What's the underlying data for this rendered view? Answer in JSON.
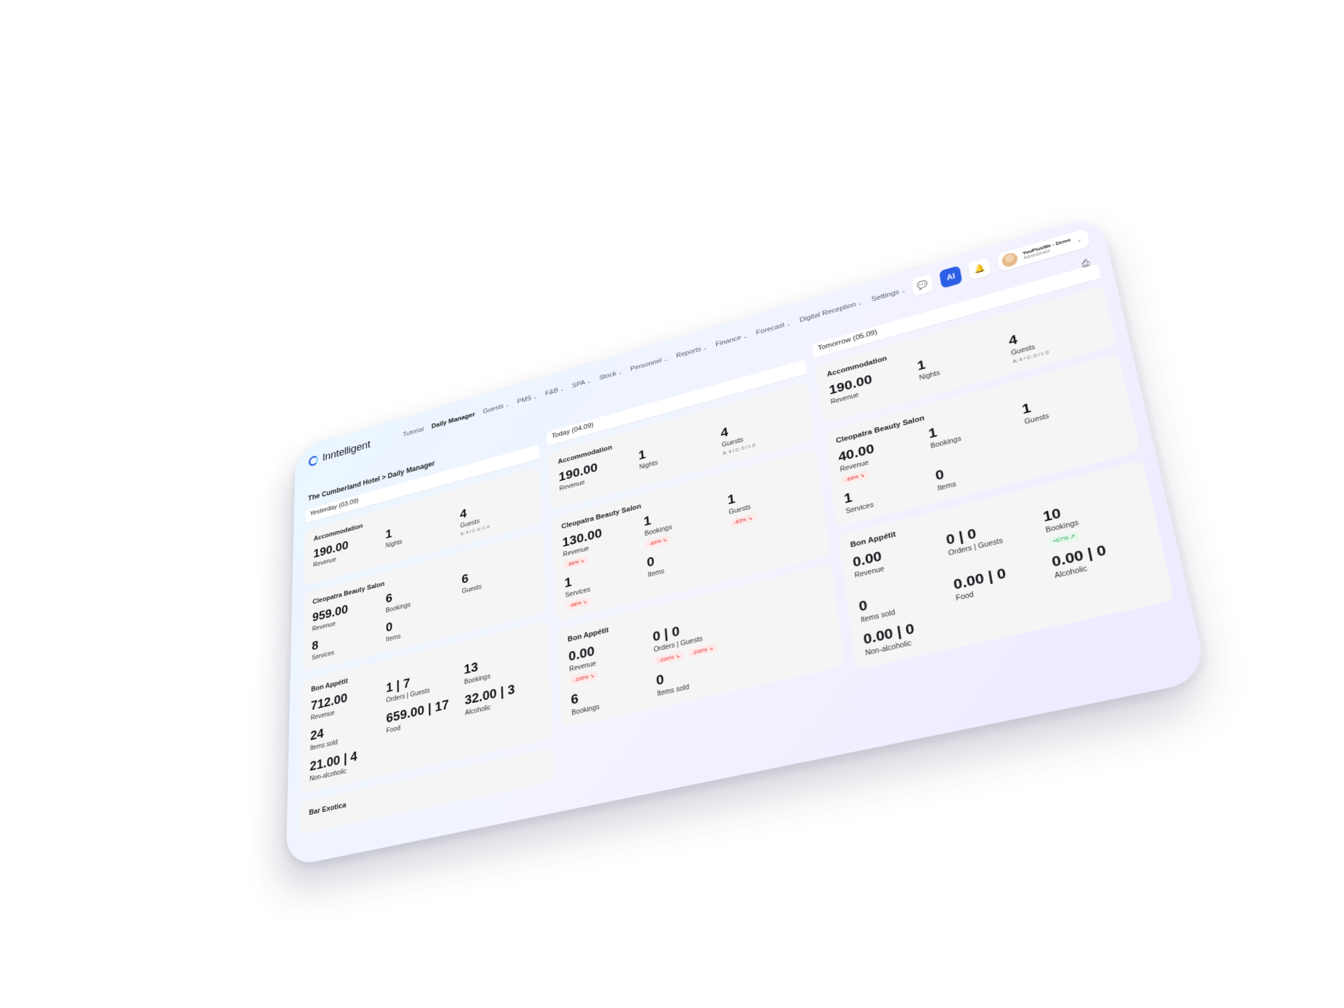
{
  "app": {
    "logo_text": "Inntelligent",
    "nav": [
      {
        "label": "Tutorial",
        "has_menu": false,
        "active": false
      },
      {
        "label": "Daily Manager",
        "has_menu": false,
        "active": true
      },
      {
        "label": "Guests",
        "has_menu": true
      },
      {
        "label": "PMS",
        "has_menu": true
      },
      {
        "label": "F&B",
        "has_menu": true
      },
      {
        "label": "SPA",
        "has_menu": true
      },
      {
        "label": "Stock",
        "has_menu": true
      },
      {
        "label": "Personnel",
        "has_menu": true
      },
      {
        "label": "Reports",
        "has_menu": true
      },
      {
        "label": "Finance",
        "has_menu": true
      },
      {
        "label": "Forecast",
        "has_menu": true
      },
      {
        "label": "Digital Reception",
        "has_menu": true
      },
      {
        "label": "Settings",
        "has_menu": true
      }
    ],
    "ai_label": "AI",
    "user": {
      "name": "YouPlusWe - Demo",
      "role": "Administrator"
    },
    "icons": {
      "chat": "chat-icon",
      "bell": "bell-icon",
      "print": "print-icon",
      "chevron": "chevron-down-icon"
    },
    "accent_color": "#2c5fe6"
  },
  "breadcrumb": "The Cumberland Hotel > Daily Manager",
  "columns": [
    {
      "heading": "Yesterday (03.09)",
      "cards": [
        {
          "title": "Accommodation",
          "metrics": [
            {
              "value": "190.00",
              "label": "Revenue"
            },
            {
              "value": "1",
              "label": "Nights"
            },
            {
              "value": "4",
              "label": "Guests",
              "sub": "A: 4 / C: 0 / I: 0"
            }
          ]
        },
        {
          "title": "Cleopatra Beauty Salon",
          "metrics": [
            {
              "value": "959.00",
              "label": "Revenue"
            },
            {
              "value": "6",
              "label": "Bookings"
            },
            {
              "value": "6",
              "label": "Guests"
            },
            {
              "value": "8",
              "label": "Services"
            },
            {
              "value": "0",
              "label": "Items"
            }
          ]
        },
        {
          "title": "Bon Appétit",
          "metrics": [
            {
              "value": "712.00",
              "label": "Revenue"
            },
            {
              "value": "1 | 7",
              "label": "Orders | Guests"
            },
            {
              "value": "13",
              "label": "Bookings"
            },
            {
              "value": "24",
              "label": "Items sold"
            },
            {
              "value": "659.00 | 17",
              "label": "Food"
            },
            {
              "value": "32.00 | 3",
              "label": "Alcoholic"
            },
            {
              "value": "21.00 | 4",
              "label": "Non-alcoholic"
            }
          ]
        },
        {
          "title": "Bar Exotica",
          "metrics": []
        }
      ]
    },
    {
      "heading": "Today (04.09)",
      "cards": [
        {
          "title": "Accommodation",
          "metrics": [
            {
              "value": "190.00",
              "label": "Revenue"
            },
            {
              "value": "1",
              "label": "Nights"
            },
            {
              "value": "4",
              "label": "Guests",
              "sub": "A: 4 / C: 0 / I: 0"
            }
          ]
        },
        {
          "title": "Cleopatra Beauty Salon",
          "metrics": [
            {
              "value": "130.00",
              "label": "Revenue",
              "pills": [
                {
                  "text": "-86% ↘",
                  "kind": "neg"
                }
              ]
            },
            {
              "value": "1",
              "label": "Bookings",
              "pills": [
                {
                  "text": "-83% ↘",
                  "kind": "neg"
                }
              ]
            },
            {
              "value": "1",
              "label": "Guests",
              "pills": [
                {
                  "text": "-83% ↘",
                  "kind": "neg"
                }
              ]
            },
            {
              "value": "1",
              "label": "Services",
              "pills": [
                {
                  "text": "-88% ↘",
                  "kind": "neg"
                }
              ]
            },
            {
              "value": "0",
              "label": "Items"
            }
          ]
        },
        {
          "title": "Bon Appétit",
          "metrics": [
            {
              "value": "0.00",
              "label": "Revenue",
              "pills": [
                {
                  "text": "-100% ↘",
                  "kind": "neg"
                }
              ]
            },
            {
              "value": "0 | 0",
              "label": "Orders | Guests",
              "pills": [
                {
                  "text": "-100% ↘",
                  "kind": "neg"
                },
                {
                  "text": "-100% ↘",
                  "kind": "neg"
                }
              ]
            },
            {
              "value": "",
              "label": ""
            },
            {
              "value": "6",
              "label": "Bookings"
            },
            {
              "value": "0",
              "label": "Items sold"
            }
          ]
        }
      ]
    },
    {
      "heading": "Tomorrow (05.09)",
      "cards": [
        {
          "title": "Accommodation",
          "metrics": [
            {
              "value": "190.00",
              "label": "Revenue"
            },
            {
              "value": "1",
              "label": "Nights"
            },
            {
              "value": "4",
              "label": "Guests",
              "sub": "A: 4 / C: 0 / I: 0"
            }
          ]
        },
        {
          "title": "Cleopatra Beauty Salon",
          "metrics": [
            {
              "value": "40.00",
              "label": "Revenue",
              "pills": [
                {
                  "text": "-69% ↘",
                  "kind": "neg"
                }
              ]
            },
            {
              "value": "1",
              "label": "Bookings"
            },
            {
              "value": "1",
              "label": "Guests"
            },
            {
              "value": "1",
              "label": "Services"
            },
            {
              "value": "0",
              "label": "Items"
            }
          ]
        },
        {
          "title": "Bon Appétit",
          "metrics": [
            {
              "value": "0.00",
              "label": "Revenue"
            },
            {
              "value": "0 | 0",
              "label": "Orders | Guests"
            },
            {
              "value": "10",
              "label": "Bookings",
              "pills": [
                {
                  "text": "+67% ↗",
                  "kind": "pos"
                }
              ]
            },
            {
              "value": "0",
              "label": "Items sold"
            },
            {
              "value": "0.00 | 0",
              "label": "Food"
            },
            {
              "value": "0.00 | 0",
              "label": "Alcoholic"
            },
            {
              "value": "0.00 | 0",
              "label": "Non-alcoholic"
            }
          ]
        }
      ]
    }
  ]
}
